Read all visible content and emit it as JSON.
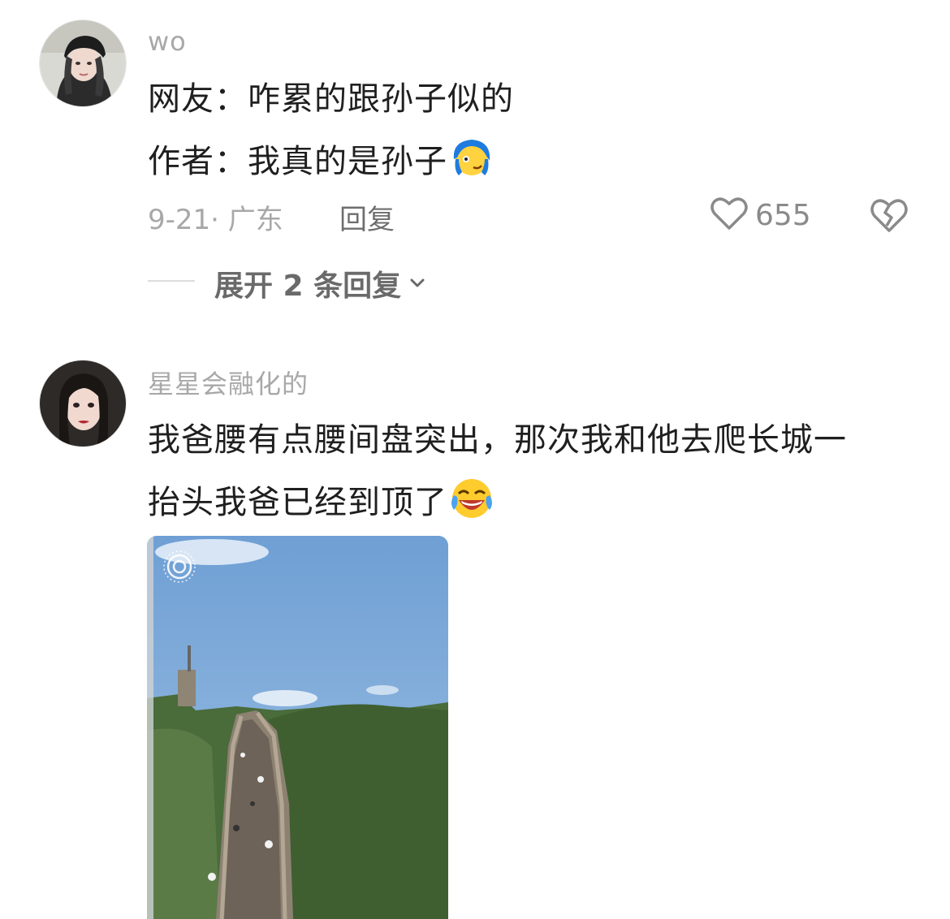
{
  "comments": [
    {
      "username": "wo",
      "lines": [
        "网友：咋累的跟孙子似的",
        "作者：我真的是孙子"
      ],
      "emoji_1": "blue-hair-face-emoji",
      "meta": "9-21· 广东",
      "reply_label": "回复",
      "likes": "655",
      "expand_label": "展开 2 条回复"
    },
    {
      "username": "星星会融化的",
      "lines": [
        "我爸腰有点腰间盘突出，那次我和他去爬长城一",
        "抬头我爸已经到顶了"
      ],
      "emoji_2": "laughing-crying-emoji",
      "photo": "great-wall-steps-photo"
    }
  ],
  "colors": {
    "text": "#1f1f1f",
    "muted": "#a8a8a8",
    "secondary": "#6a6a6a",
    "background": "#ffffff"
  }
}
